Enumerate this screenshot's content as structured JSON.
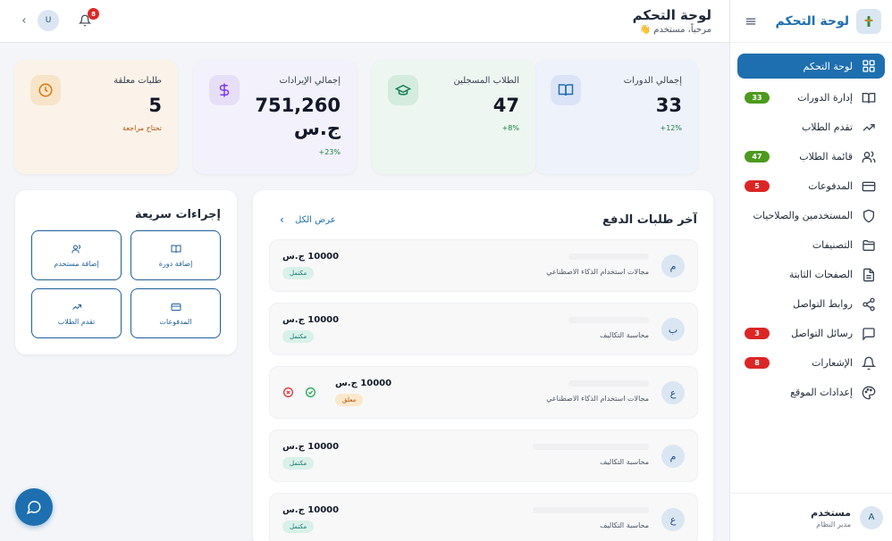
{
  "sidebar": {
    "brand_title": "لوحة التحكم",
    "items": [
      {
        "label": "لوحة التحكم",
        "icon": "grid-icon",
        "active": true,
        "badge": ""
      },
      {
        "label": "إدارة الدورات",
        "icon": "book-icon",
        "badge": "33",
        "badge_color": "green"
      },
      {
        "label": "تقدم الطلاب",
        "icon": "trending-up-icon",
        "badge": ""
      },
      {
        "label": "قائمة الطلاب",
        "icon": "users-icon",
        "badge": "47",
        "badge_color": "green"
      },
      {
        "label": "المدفوعات",
        "icon": "credit-card-icon",
        "badge": "5",
        "badge_color": "red"
      },
      {
        "label": "المستخدمين والصلاحيات",
        "icon": "shield-icon",
        "badge": ""
      },
      {
        "label": "التصنيفات",
        "icon": "folder-icon",
        "badge": ""
      },
      {
        "label": "الصفحات الثابتة",
        "icon": "file-icon",
        "badge": ""
      },
      {
        "label": "روابط التواصل",
        "icon": "share-icon",
        "badge": ""
      },
      {
        "label": "رسائل التواصل",
        "icon": "message-icon",
        "badge": "3",
        "badge_color": "red"
      },
      {
        "label": "الإشعارات",
        "icon": "bell-icon",
        "badge": "8",
        "badge_color": "red"
      },
      {
        "label": "إعدادات الموقع",
        "icon": "palette-icon",
        "badge": ""
      }
    ],
    "user": {
      "initial": "A",
      "name": "مستخدم",
      "role": "مدير النظام"
    }
  },
  "topbar": {
    "title": "لوحة التحكم",
    "welcome": "مرحباً، مستخدم 👋",
    "notifications_count": "8",
    "avatar_initial": "U"
  },
  "stats": [
    {
      "label": "إجمالي الدورات",
      "value": "33",
      "note": "12%+"
    },
    {
      "label": "الطلاب المسجلين",
      "value": "47",
      "note": "8%+"
    },
    {
      "label": "إجمالي الإيرادات",
      "value": "751,260 ج.س",
      "note": "23%+"
    },
    {
      "label": "طلبات معلقة",
      "value": "5",
      "note": "تحتاج مراجعة"
    }
  ],
  "payments": {
    "title": "آخر طلبات الدفع",
    "view_all": "عرض الكل",
    "rows": [
      {
        "initial": "م",
        "course": "مجالات استخدام الذكاء الاصطناعي",
        "amount": "10000 ج.س",
        "status": "مكتمل"
      },
      {
        "initial": "ب",
        "course": "محاسبة التكاليف",
        "amount": "10000 ج.س",
        "status": "مكتمل"
      },
      {
        "initial": "ع",
        "course": "مجالات استخدام الذكاء الاصطناعي",
        "amount": "10000 ج.س",
        "status": "معلق"
      },
      {
        "initial": "م",
        "course": "محاسبة التكاليف",
        "amount": "10000 ج.س",
        "status": "مكتمل"
      },
      {
        "initial": "ع",
        "course": "محاسبة التكاليف",
        "amount": "10000 ج.س",
        "status": "مكتمل"
      }
    ]
  },
  "quick_actions": {
    "title": "إجراءات سريعة",
    "buttons": [
      {
        "label": "إضافة دورة",
        "icon": "book-icon"
      },
      {
        "label": "إضافة مستخدم",
        "icon": "users-icon"
      },
      {
        "label": "المدفوعات",
        "icon": "credit-card-icon"
      },
      {
        "label": "تقدم الطلاب",
        "icon": "trending-up-icon"
      }
    ]
  },
  "colors": {
    "primary": "#1e6fb0",
    "badge_green": "#4d9a1e",
    "badge_red": "#dc2626"
  }
}
